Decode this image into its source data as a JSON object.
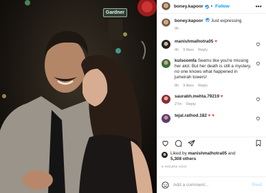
{
  "photo": {
    "sign_text": "Gardner"
  },
  "post": {
    "username": "boney.kapoor",
    "follow_label": "Follow",
    "separator": "•",
    "more": "•••"
  },
  "caption": {
    "username": "boney.kapoor",
    "text": "Just expressing",
    "time": "9h"
  },
  "comments": [
    {
      "username": "manishmalhotra05",
      "text": "♥",
      "time": "4h",
      "likes": "5 likes",
      "reply": "Reply"
    },
    {
      "username": "kulsoomfa",
      "text": "Seems like you're missing her alot. But her death is still a mystery, no one knows what happened in jumeirah towers!",
      "time": "8h",
      "likes": "9 likes",
      "reply": "Reply"
    },
    {
      "username": "saurabh.mehta.79219",
      "text": "♥",
      "time": "27m",
      "reply": "Reply"
    },
    {
      "username": "tejal.rathod.182",
      "text": "♥ ♥"
    }
  ],
  "likes": {
    "prefix": "Liked by",
    "user": "manishmalhotra05",
    "connector": "and",
    "others": "5,308 others"
  },
  "time_ago": "9 HOURS AGO",
  "add_comment": {
    "placeholder": "Add a comment...",
    "post_label": "Post"
  },
  "colors": {
    "accent": "#0095f6",
    "heart": "#ed4956",
    "muted": "#8e8e8e"
  },
  "icons": [
    "heart-icon",
    "comment-icon",
    "share-icon",
    "bookmark-icon",
    "emoji-icon",
    "verified-icon",
    "more-icon"
  ]
}
